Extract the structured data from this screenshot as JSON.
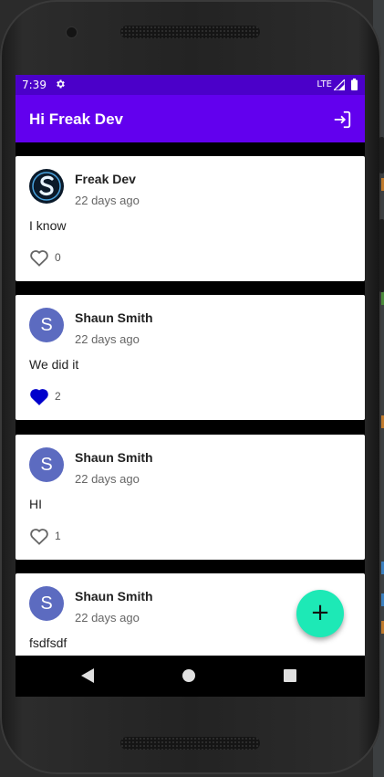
{
  "status_bar": {
    "time": "7:39",
    "network": "LTE"
  },
  "app_bar": {
    "title": "Hi Freak Dev"
  },
  "posts": [
    {
      "author": "Freak Dev",
      "time": "22 days ago",
      "text": "I know",
      "likes": "0",
      "liked": false,
      "avatar_letter": ""
    },
    {
      "author": "Shaun Smith",
      "time": "22 days ago",
      "text": "We did it",
      "likes": "2",
      "liked": true,
      "avatar_letter": "S"
    },
    {
      "author": "Shaun Smith",
      "time": "22 days ago",
      "text": "HI",
      "likes": "1",
      "liked": false,
      "avatar_letter": "S"
    },
    {
      "author": "Shaun Smith",
      "time": "22 days ago",
      "text": "fsdfsdf",
      "likes": "",
      "liked": false,
      "avatar_letter": "S"
    }
  ],
  "fab": {
    "label": "+"
  },
  "colors": {
    "status_bar": "#4b00c9",
    "app_bar": "#6200ee",
    "fab": "#1de9b6",
    "liked": "#0000cc",
    "avatar": "#5c6bc0"
  }
}
